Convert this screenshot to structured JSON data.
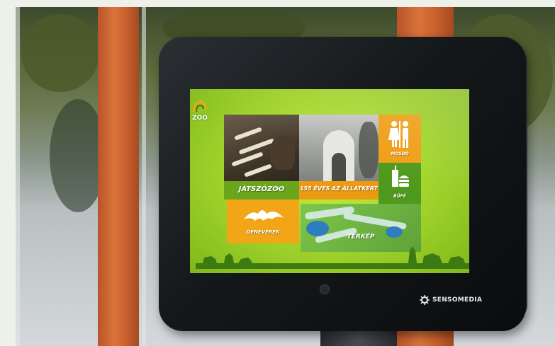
{
  "screen": {
    "logo_text": "ZOO",
    "tiles": {
      "playground_label": "JÁTSZÓZOO",
      "history_label": "155 ÉVES AZ ÁLLATKERT",
      "restroom_label": "MOSDÓ",
      "buffet_label": "BÜFÉ",
      "bats_label": "DENEVÉREK",
      "map_label": "TÉRKÉP"
    }
  },
  "kiosk": {
    "brand_label": "SENSOMEDIA"
  },
  "colors": {
    "screen_green": "#9fd22a",
    "tile_orange": "#ef9e16",
    "tile_green": "#4f9a1c",
    "pillar_orange": "#d9743a",
    "bezel_black": "#15181b"
  }
}
